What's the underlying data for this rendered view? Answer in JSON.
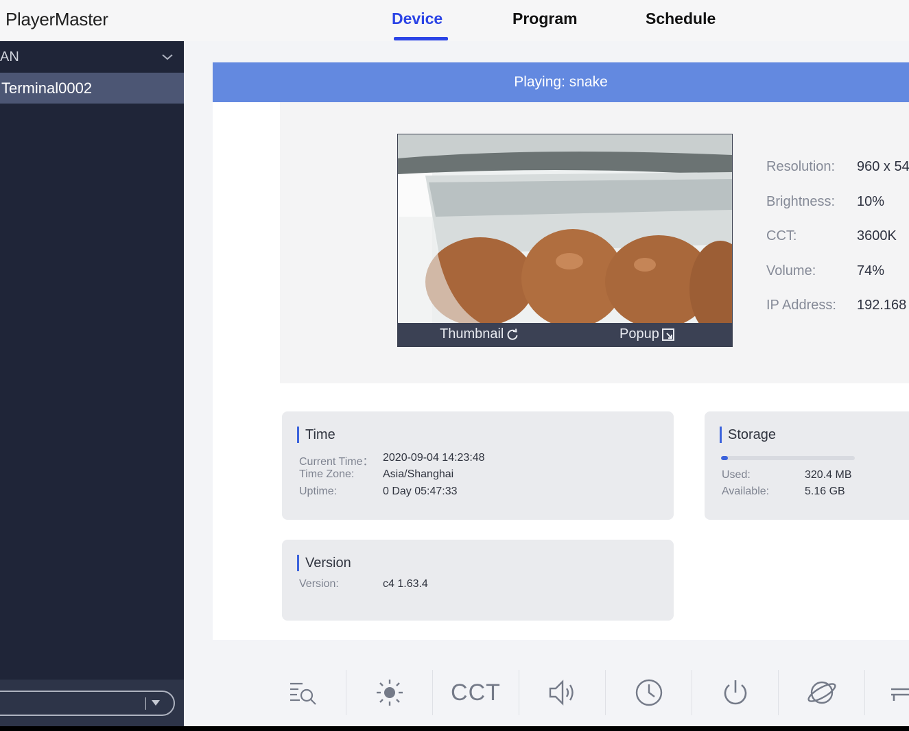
{
  "app": {
    "title": "PlayerMaster"
  },
  "tabs": [
    {
      "label": "Device",
      "active": true
    },
    {
      "label": "Program",
      "active": false
    },
    {
      "label": "Schedule",
      "active": false
    }
  ],
  "sidebar": {
    "group_label": "AN",
    "terminal_label": "Terminal0002",
    "footer_select_value": ""
  },
  "player": {
    "playing_text": "Playing: snake",
    "thumbnail_label": "Thumbnail",
    "popup_label": "Popup"
  },
  "device_info": [
    {
      "label": "Resolution:",
      "value": "960 x 54"
    },
    {
      "label": "Brightness:",
      "value": "10%"
    },
    {
      "label": "CCT:",
      "value": "3600K"
    },
    {
      "label": "Volume:",
      "value": "74%"
    },
    {
      "label": "IP Address:",
      "value": "192.168"
    }
  ],
  "time_box": {
    "title": "Time",
    "rows": [
      {
        "label": "Current Time：",
        "value": "2020-09-04 14:23:48"
      },
      {
        "label": "Time Zone:",
        "value": "Asia/Shanghai"
      },
      {
        "label": "Uptime:",
        "value": "0 Day 05:47:33"
      }
    ]
  },
  "storage_box": {
    "title": "Storage",
    "used_fraction": 0.05,
    "rows": [
      {
        "label": "Used:",
        "value": "320.4 MB"
      },
      {
        "label": "Available:",
        "value": "5.16 GB"
      }
    ]
  },
  "version_box": {
    "title": "Version",
    "rows": [
      {
        "label": "Version:",
        "value": "c4 1.63.4"
      }
    ]
  },
  "toolbar": {
    "cct_label": "CCT",
    "icons": [
      "search-log-icon",
      "brightness-icon",
      "cct-text",
      "volume-icon",
      "clock-icon",
      "power-icon",
      "network-icon",
      "more-icon"
    ]
  },
  "colors": {
    "accent": "#2b44e6",
    "playing_bar": "#6389e0",
    "sidebar_bg": "#1f2538",
    "sidebar_selected": "#4c5674"
  }
}
